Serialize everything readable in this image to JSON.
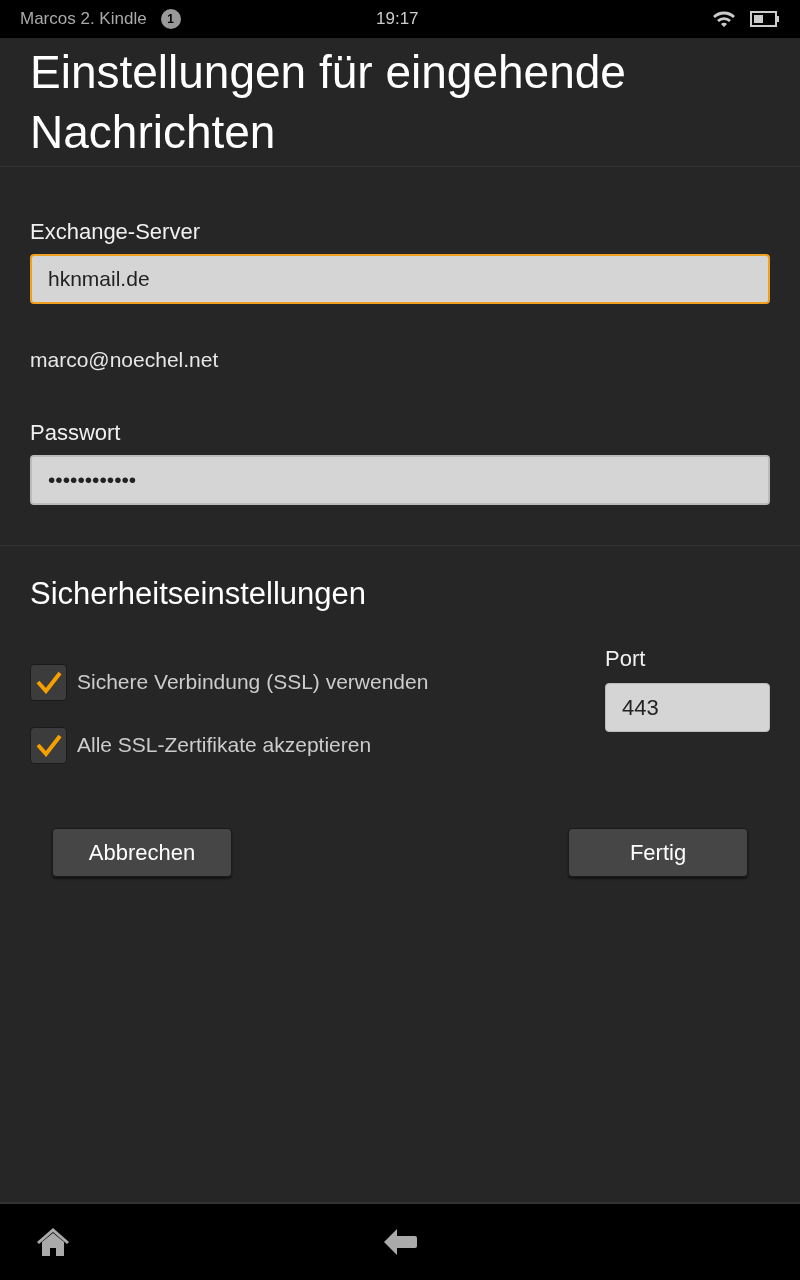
{
  "status_bar": {
    "device_name": "Marcos 2. Kindle",
    "notification_count": "1",
    "time": "19:17"
  },
  "title": "Einstellungen für eingehende Nachrichten",
  "fields": [
    {
      "kind": "input",
      "label": "Exchange-Server",
      "value": "hknmail.de",
      "focused": true
    },
    {
      "kind": "text",
      "value": "marco@noechel.net"
    },
    {
      "kind": "input",
      "label": "Passwort",
      "value": "••••••••••••",
      "focused": false
    }
  ],
  "security": {
    "heading": "Sicherheitseinstellungen",
    "checkboxes": [
      {
        "label": "Sichere Verbindung (SSL) verwenden",
        "checked": true
      },
      {
        "label": "Alle SSL-Zertifikate akzeptieren",
        "checked": true
      }
    ],
    "port": {
      "label": "Port",
      "value": "443"
    }
  },
  "buttons": [
    "Abbrechen",
    "Fertig"
  ]
}
